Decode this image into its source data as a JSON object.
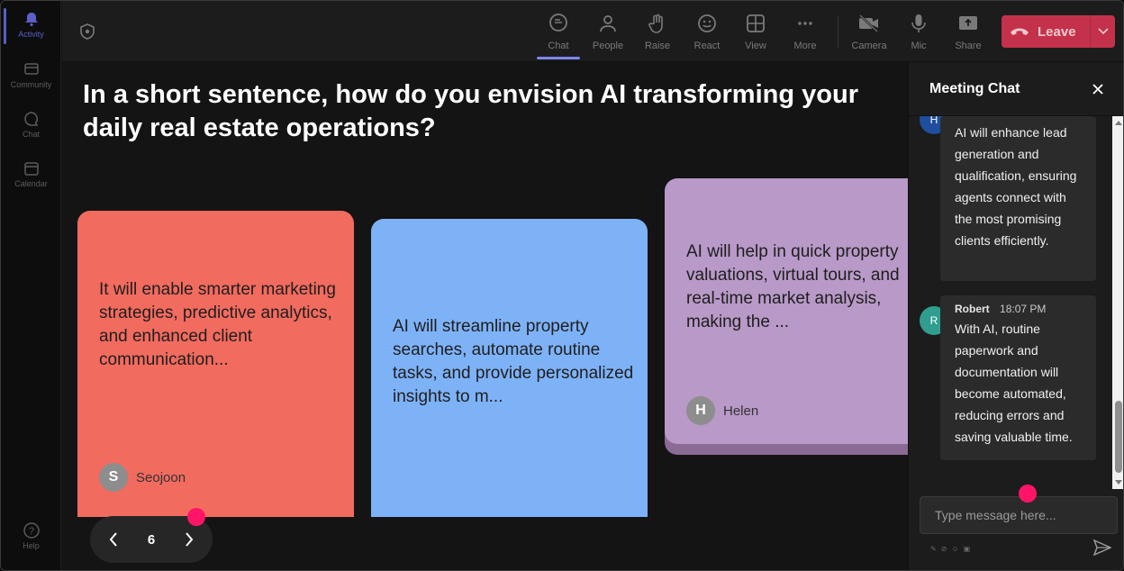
{
  "rail": {
    "items": [
      {
        "label": "Activity",
        "icon": "bell-icon"
      },
      {
        "label": "Community",
        "icon": "community-icon"
      },
      {
        "label": "Chat",
        "icon": "chat-icon"
      },
      {
        "label": "Calendar",
        "icon": "calendar-icon"
      },
      {
        "label": "Help",
        "icon": "help-icon"
      }
    ]
  },
  "toolbar": {
    "chat": "Chat",
    "people": "People",
    "raise": "Raise",
    "react": "React",
    "view": "View",
    "more": "More",
    "camera": "Camera",
    "mic": "Mic",
    "share": "Share",
    "leave": "Leave"
  },
  "stage": {
    "question": "In a short sentence, how do you envision AI transforming your daily real estate operations?",
    "cards": [
      {
        "text": "It will enable smarter marketing strategies, predictive analytics, and enhanced client communication...",
        "author": "Seojoon",
        "initial": "S",
        "color": "#f26b5f"
      },
      {
        "text": "AI will streamline property searches, automate routine tasks, and provide personalized insights to m...",
        "author": "",
        "initial": "",
        "color": "#7eb2f7"
      },
      {
        "text_lines": [
          "AI will help in quick property",
          "valuations, virtual tours, and",
          "real-time market analysis,",
          "making the ..."
        ],
        "author": "Helen",
        "initial": "H",
        "color": "#b899c7"
      }
    ],
    "page": "6"
  },
  "chat": {
    "title": "Meeting Chat",
    "messages": [
      {
        "initial": "H",
        "avatar_color": "#1f4e9e",
        "author": "",
        "time": "",
        "text": "AI will enhance lead generation and qualification, ensuring agents connect with the most promising clients efficiently."
      },
      {
        "initial": "R",
        "avatar_color": "#2f9e8f",
        "author": "Robert",
        "time": "18:07 PM",
        "text": "With AI, routine paperwork and documentation will become automated, reducing errors and saving valuable time."
      }
    ],
    "input_placeholder": "Type message here..."
  },
  "colors": {
    "accent": "#7f85f5",
    "leave": "#c4314b",
    "marker": "#ff1468"
  }
}
